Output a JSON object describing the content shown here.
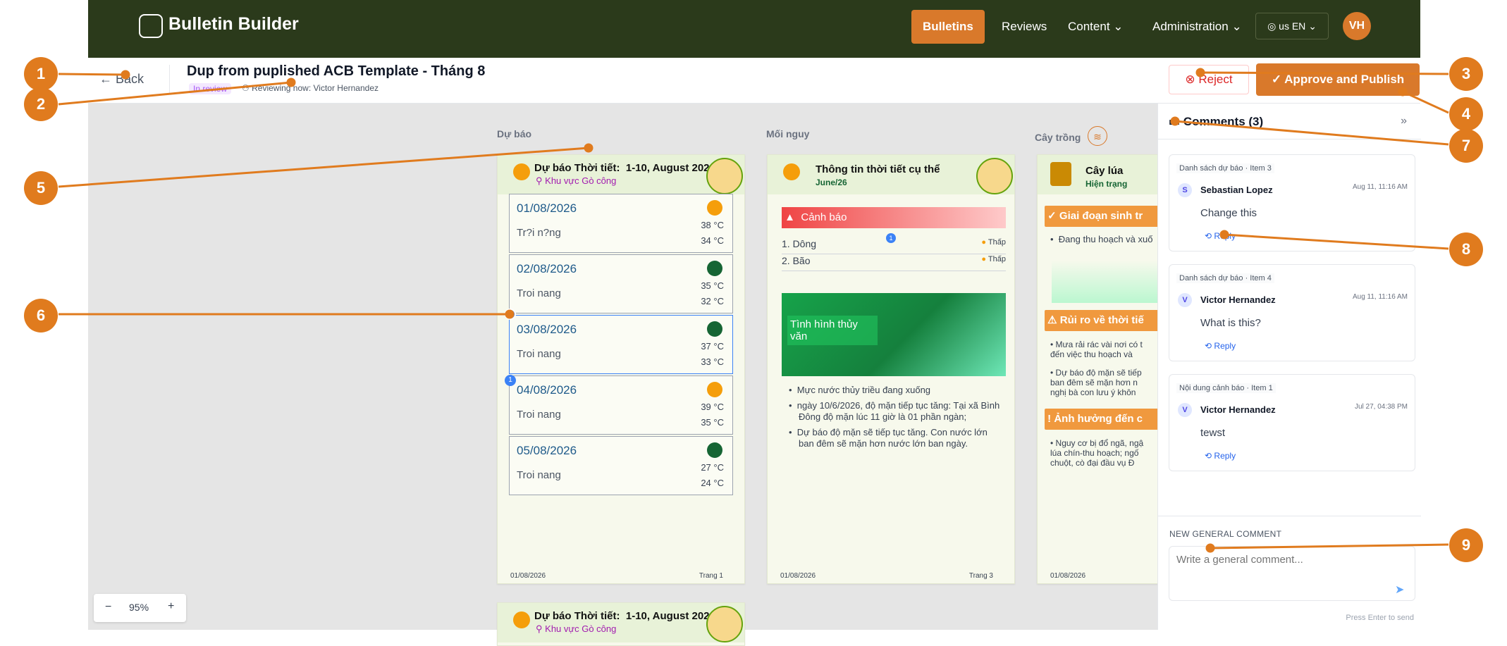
{
  "navbar": {
    "brand": "Bulletin Builder",
    "items": [
      "Bulletins",
      "Reviews",
      "Content",
      "Administration"
    ],
    "language": "us EN",
    "user_initials": "VH"
  },
  "subheader": {
    "back_label": "Back",
    "title": "Dup from puplished ACB Template - Tháng 8",
    "status": "In review",
    "reviewing_label": "Reviewing now:",
    "reviewing_user": "Victor Hernandez",
    "reject_label": "Reject",
    "approve_label": "Approve and Publish"
  },
  "canvas": {
    "columns": [
      "Dự báo",
      "Mối nguy",
      "Cây trồng"
    ],
    "zoom": "95%",
    "page1": {
      "title": "Dự báo Thời tiết:",
      "date_range": "1-10, August 2026",
      "area": "Khu vực Gò công",
      "days": [
        {
          "date": "01/08/2026",
          "cond": "Tr?i n?ng",
          "t1": "38 °C",
          "t2": "34 °C"
        },
        {
          "date": "02/08/2026",
          "cond": "Troi nang",
          "t1": "35 °C",
          "t2": "32 °C"
        },
        {
          "date": "03/08/2026",
          "cond": "Troi nang",
          "t1": "37 °C",
          "t2": "33 °C"
        },
        {
          "date": "04/08/2026",
          "cond": "Troi nang",
          "t1": "39 °C",
          "t2": "35 °C"
        },
        {
          "date": "05/08/2026",
          "cond": "Troi nang",
          "t1": "27 °C",
          "t2": "24 °C"
        }
      ],
      "footer_date": "01/08/2026",
      "footer_page": "Trang 1",
      "badge": "1"
    },
    "page2": {
      "title": "Thông tin thời tiết cụ thể",
      "subtitle": "June/26",
      "warning": "Cảnh báo",
      "hazards": [
        {
          "name": "1.  Dông",
          "level": "Thấp"
        },
        {
          "name": "2.  Bão",
          "level": "Thấp"
        }
      ],
      "badge": "1",
      "image_caption": "Tình hình thủy văn",
      "bullets": [
        "Mực nước thủy triều đang xuống",
        "ngày 10/6/2026, độ mặn tiếp tục tăng: Tại xã Bình Đông độ mặn lúc 11 giờ là 01 phần ngàn;",
        "Dự báo độ mặn sẽ tiếp tục tăng. Con nước lớn ban đêm sẽ mặn hơn nước lớn ban ngày."
      ],
      "footer_date": "01/08/2026",
      "footer_page": "Trang 3"
    },
    "page3": {
      "title": "Cây lúa",
      "subtitle": "Hiện trạng",
      "sections": [
        "Giai đoạn sinh tr",
        "Rủi ro về thời tiế",
        "Ảnh hưởng đến c"
      ],
      "bullet1": "Đang thu hoạch và xuố",
      "bullet2": "Mưa rải rác vài nơi có t đến việc thu hoạch và",
      "bullet3": "Dự báo độ mặn sẽ tiếp ban đêm sẽ mặn hơn n nghị bà con lưu ý khôn",
      "bullet4": "Nguy cơ bị đổ ngã, ngậ lúa chín-thu hoạch; ngố chuột, cò đại đầu vụ Đ",
      "footer_date": "01/08/2026"
    },
    "page4": {
      "title": "Dự báo Thời tiết:",
      "date_range": "1-10, August 2026",
      "area": "Khu vực Gò công"
    }
  },
  "comments": {
    "title": "Comments (3)",
    "items": [
      {
        "context": "Danh sách dự báo · Item 3",
        "initial": "S",
        "author": "Sebastian Lopez",
        "time": "Aug 11, 11:16 AM",
        "body": "Change this",
        "reply": "Reply"
      },
      {
        "context": "Danh sách dự báo · Item 4",
        "initial": "V",
        "author": "Victor Hernandez",
        "time": "Aug 11, 11:16 AM",
        "body": "What is this?",
        "reply": "Reply"
      },
      {
        "context": "Nội dung cảnh báo · Item 1",
        "initial": "V",
        "author": "Victor Hernandez",
        "time": "Jul 27, 04:38 PM",
        "body": "tewst",
        "reply": "Reply"
      }
    ],
    "new_label": "NEW GENERAL COMMENT",
    "placeholder": "Write a general comment...",
    "hint": "Press Enter to send"
  },
  "markers": [
    "1",
    "2",
    "3",
    "4",
    "5",
    "6",
    "7",
    "8",
    "9"
  ],
  "colors": {
    "navbar": "#2b3a1b",
    "accent": "#d9792b",
    "marker": "#e07b1e",
    "link": "#2563eb",
    "reject": "#dc2626"
  }
}
